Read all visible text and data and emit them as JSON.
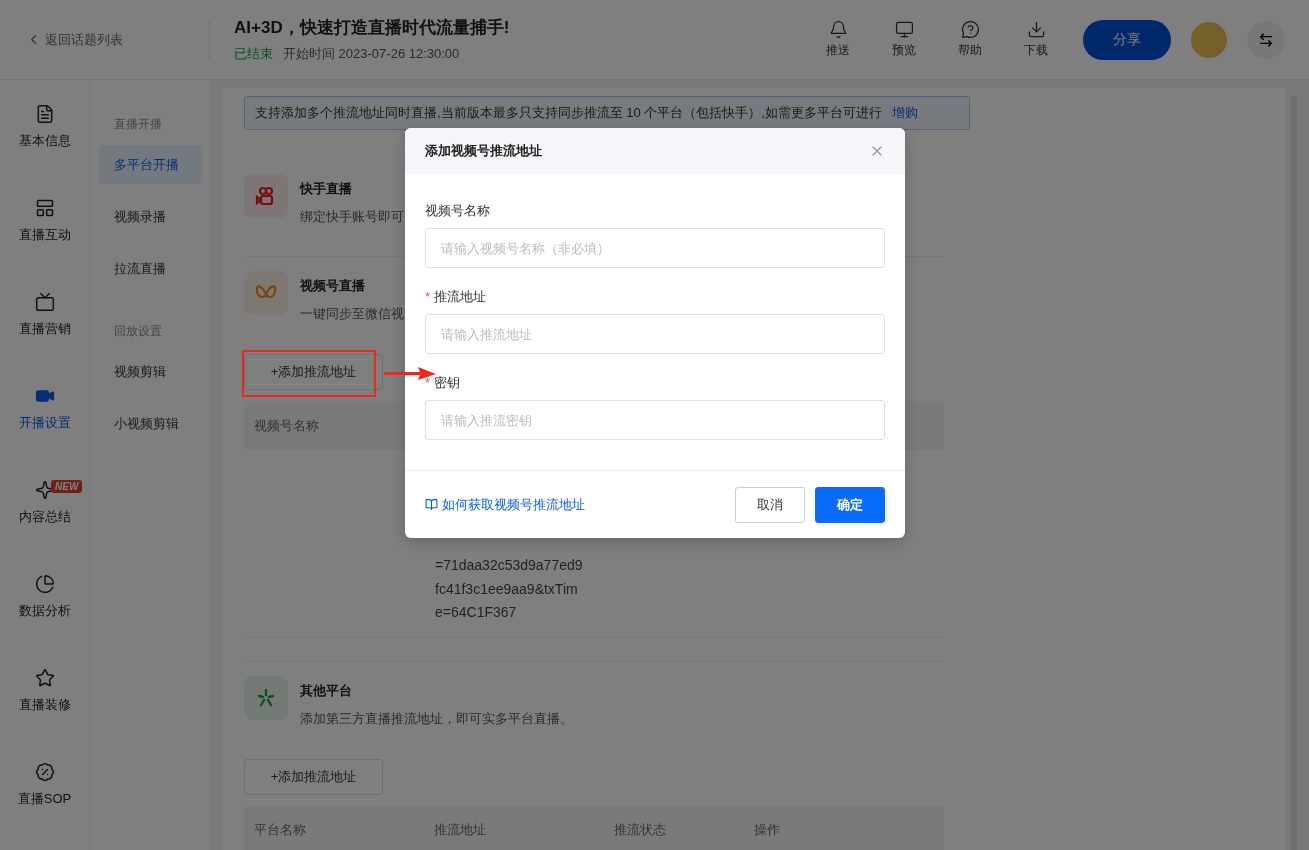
{
  "header": {
    "back_link": "返回话题列表",
    "title": "AI+3D，快速打造直播时代流量捕手!",
    "status": "已结束",
    "start_time": "开始时间 2023-07-26 12:30:00",
    "actions": [
      {
        "kind": "bell",
        "label": "推送"
      },
      {
        "kind": "monitor",
        "label": "预览"
      },
      {
        "kind": "help",
        "label": "帮助"
      },
      {
        "kind": "download",
        "label": "下载"
      }
    ],
    "share_button": "分享"
  },
  "sidebar": {
    "items": [
      {
        "kind": "doc",
        "label": "基本信息",
        "selected": false
      },
      {
        "kind": "layout",
        "label": "直播互动",
        "selected": false
      },
      {
        "kind": "tv",
        "label": "直播营销",
        "selected": false
      },
      {
        "kind": "video",
        "label": "开播设置",
        "selected": true
      },
      {
        "kind": "sparkle",
        "label": "内容总结",
        "selected": false,
        "badge": "NEW"
      },
      {
        "kind": "pie",
        "label": "数据分析",
        "selected": false
      },
      {
        "kind": "star",
        "label": "直播装修",
        "selected": false
      },
      {
        "kind": "sop",
        "label": "直播SOP",
        "selected": false
      }
    ]
  },
  "subnav": {
    "groups": [
      {
        "title": "直播开播",
        "items": [
          {
            "label": "多平台开播",
            "selected": true
          },
          {
            "label": "视频录播",
            "selected": false
          },
          {
            "label": "拉流直播",
            "selected": false
          }
        ]
      },
      {
        "title": "回放设置",
        "items": [
          {
            "label": "视频剪辑",
            "selected": false
          },
          {
            "label": "小视频剪辑",
            "selected": false
          }
        ]
      }
    ]
  },
  "content": {
    "banner": {
      "text": "支持添加多个推流地址同时直播,当前版本最多只支持同步推流至 10 个平台（包括快手）,如需更多平台可进行",
      "link": "增购"
    },
    "platforms": [
      {
        "kind": "kuaishou",
        "title": "快手直播",
        "description": "绑定快手账号即可"
      },
      {
        "kind": "channels",
        "title": "视频号直播",
        "description": "一键同步至微信视",
        "add_button": "+添加推流地址",
        "highlighted": true,
        "table": {
          "columns": [
            "视频号名称"
          ],
          "address_lines": [
            "=71daa32c53d9a77ed9",
            "fc41f3c1ee9aa9&txTim",
            "e=64C1F367"
          ]
        }
      },
      {
        "kind": "other",
        "title": "其他平台",
        "description": "添加第三方直播推流地址，即可实多平台直播。",
        "add_button": "+添加推流地址",
        "highlighted": false,
        "table": {
          "columns": [
            "平台名称",
            "推流地址",
            "推流状态",
            "操作"
          ]
        }
      }
    ]
  },
  "modal": {
    "title": "添加视频号推流地址",
    "required_mark": "*",
    "fields": [
      {
        "label": "视频号名称",
        "required": false,
        "placeholder": "请输入视频号名称（非必填）"
      },
      {
        "label": "推流地址",
        "required": true,
        "placeholder": "请输入推流地址"
      },
      {
        "label": "密钥",
        "required": true,
        "placeholder": "请输入推流密钥"
      }
    ],
    "help_link": "如何获取视频号推流地址",
    "buttons": [
      {
        "label": "取消",
        "kind": "secondary"
      },
      {
        "label": "确定",
        "kind": "primary"
      }
    ]
  }
}
